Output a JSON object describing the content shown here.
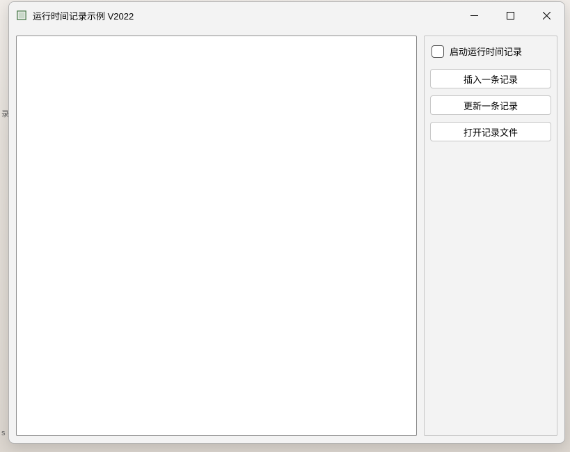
{
  "window": {
    "title": "运行时间记录示例 V2022"
  },
  "textarea": {
    "value": ""
  },
  "sidepanel": {
    "checkbox_label": "启动运行时间记录",
    "checkbox_checked": false,
    "buttons": {
      "insert": "插入一条记录",
      "update": "更新一条记录",
      "open": "打开记录文件"
    }
  },
  "background": {
    "frag1": "录",
    "frag2": "s"
  }
}
